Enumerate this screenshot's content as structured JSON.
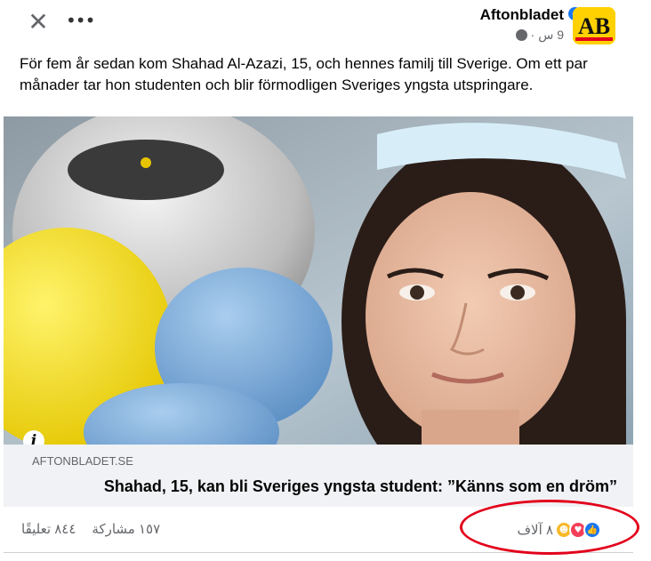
{
  "header": {
    "close_glyph": "✕",
    "more_glyph": "•••",
    "page_name": "Aftonbladet",
    "time": "9 س",
    "separator": "·",
    "privacy_icon": "globe-icon",
    "verified_icon": "verified-badge-icon",
    "avatar_text": "AB"
  },
  "post": {
    "text": "För fem år sedan kom Shahad Al-Azazi, 15, och hennes familj till Sverige. Om ett par månader tar hon studenten och blir förmodligen Sveriges yngsta utspringare."
  },
  "link_preview": {
    "domain": "AFTONBLADET.SE",
    "title": "Shahad, 15, kan bli Sveriges yngsta student: ”Känns som en dröm”",
    "info_glyph": "i"
  },
  "stats": {
    "reactions_count": "٨ آلاف",
    "reaction_types": [
      "like",
      "love",
      "care"
    ],
    "comments": "٨٤٤ تعليقًا",
    "shares": "١٥٧ مشاركة"
  },
  "colors": {
    "accent": "#1877f2",
    "love": "#f33e58",
    "care": "#f7b928",
    "annotation": "#e3001b",
    "brand_yellow": "#ffd100",
    "brand_red": "#e3001b"
  }
}
